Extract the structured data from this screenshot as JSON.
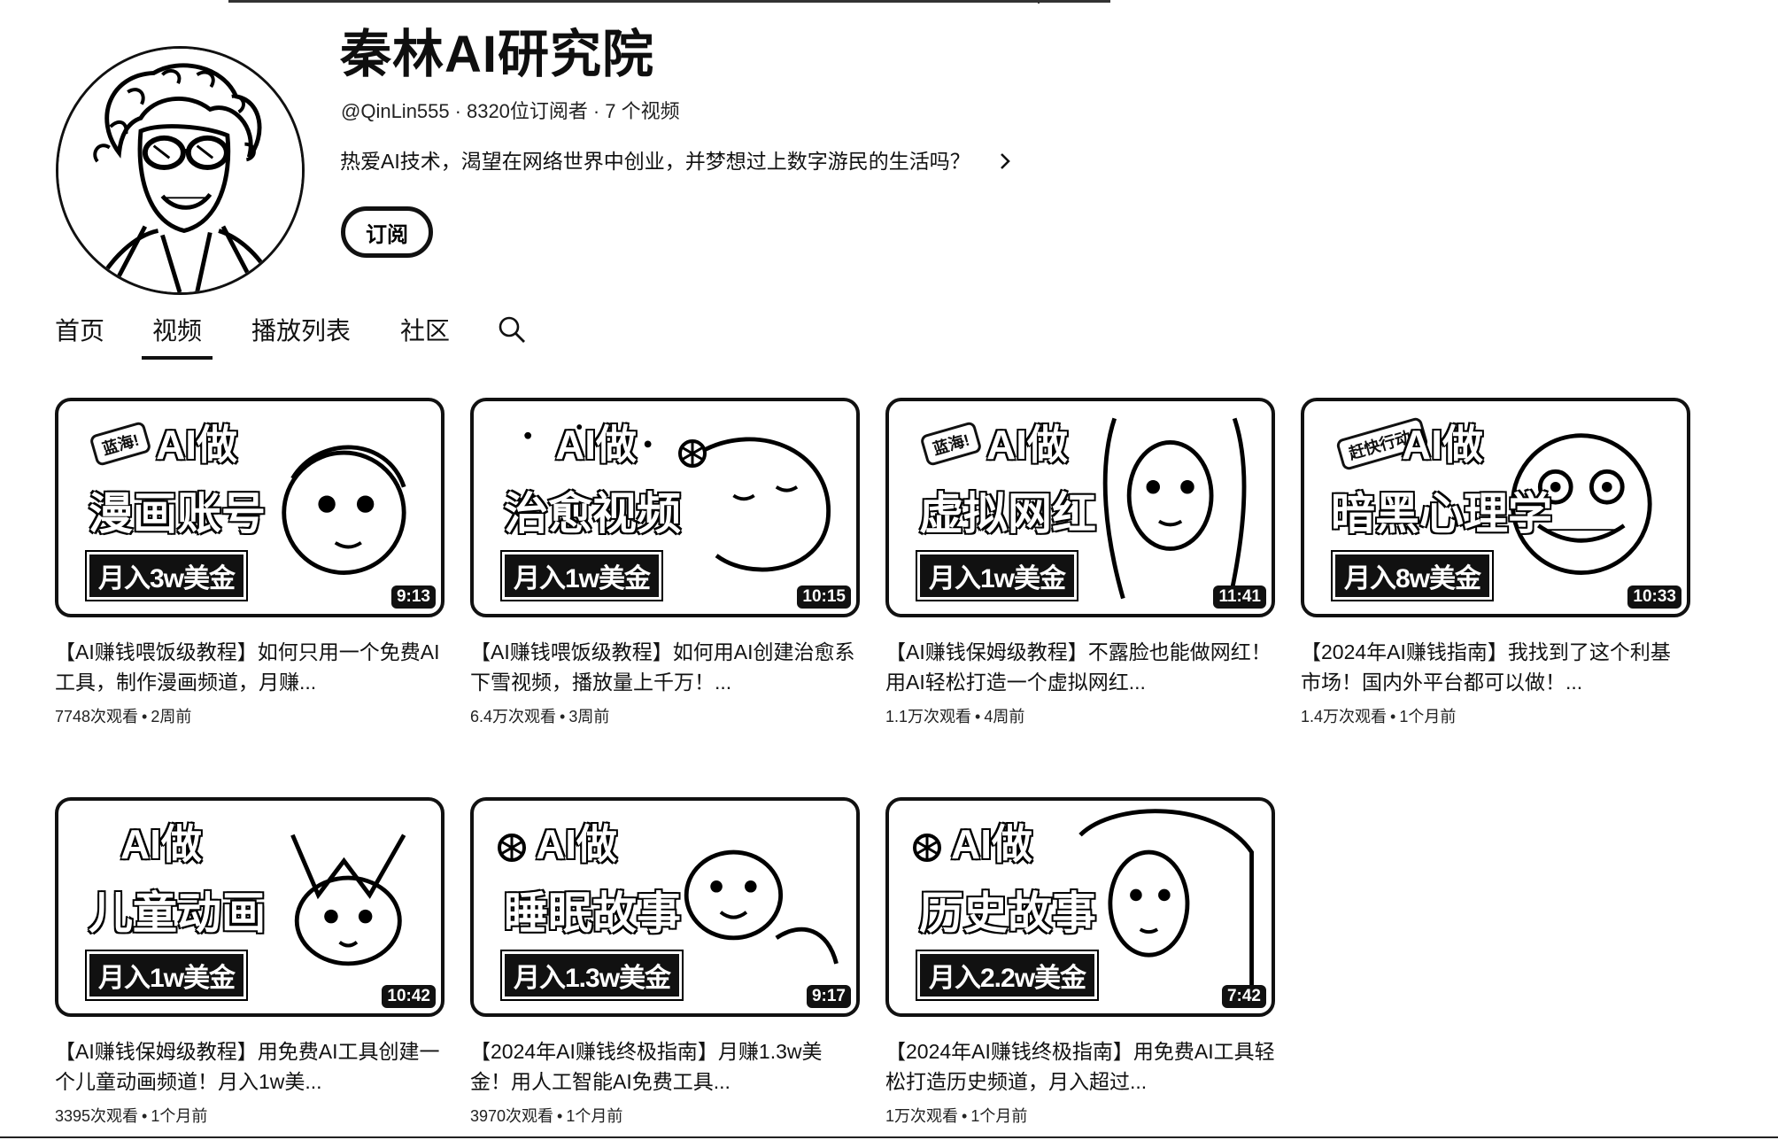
{
  "channel": {
    "name": "秦林AI研究院",
    "handle": "@QinLin555",
    "subscribers": "8320位订阅者",
    "video_count": "7 个视频",
    "description": "热爱AI技术，渴望在网络世界中创业，并梦想过上数字游民的生活吗？",
    "subscribe_label": "订阅",
    "meta_separator": "·"
  },
  "tabs": [
    {
      "label": "首页",
      "active": false
    },
    {
      "label": "视频",
      "active": true
    },
    {
      "label": "播放列表",
      "active": false
    },
    {
      "label": "社区",
      "active": false
    }
  ],
  "videos": [
    {
      "badge": "蓝海!",
      "headline_1": "AI做",
      "headline_2": "漫画账号",
      "tagline": "月入3w美金",
      "duration": "9:13",
      "title": "【AI赚钱喂饭级教程】如何只用一个免费AI工具，制作漫画频道，月赚...",
      "views": "7748次观看",
      "age": "2周前"
    },
    {
      "badge": "",
      "headline_1": "AI做",
      "headline_2": "治愈视频",
      "tagline": "月入1w美金",
      "duration": "10:15",
      "title": "【AI赚钱喂饭级教程】如何用AI创建治愈系下雪视频，播放量上千万！...",
      "views": "6.4万次观看",
      "age": "3周前"
    },
    {
      "badge": "蓝海!",
      "headline_1": "AI做",
      "headline_2": "虚拟网红",
      "tagline": "月入1w美金",
      "duration": "11:41",
      "title": "【AI赚钱保姆级教程】不露脸也能做网红！用AI轻松打造一个虚拟网红...",
      "views": "1.1万次观看",
      "age": "4周前"
    },
    {
      "badge": "赶快行动!",
      "headline_1": "AI做",
      "headline_2": "暗黑心理学",
      "tagline": "月入8w美金",
      "duration": "10:33",
      "title": "【2024年AI赚钱指南】我找到了这个利基市场！国内外平台都可以做！...",
      "views": "1.4万次观看",
      "age": "1个月前"
    },
    {
      "badge": "",
      "headline_1": "AI做",
      "headline_2": "儿童动画",
      "tagline": "月入1w美金",
      "duration": "10:42",
      "title": "【AI赚钱保姆级教程】用免费AI工具创建一个儿童动画频道！月入1w美...",
      "views": "3395次观看",
      "age": "1个月前"
    },
    {
      "badge": "",
      "headline_1": "AI做",
      "headline_2": "睡眠故事",
      "tagline": "月入1.3w美金",
      "duration": "9:17",
      "title": "【2024年AI赚钱终极指南】月赚1.3w美金！用人工智能AI免费工具...",
      "views": "3970次观看",
      "age": "1个月前"
    },
    {
      "badge": "",
      "headline_1": "AI做",
      "headline_2": "历史故事",
      "tagline": "月入2.2w美金",
      "duration": "7:42",
      "title": "【2024年AI赚钱终极指南】用免费AI工具轻松打造历史频道，月入超过...",
      "views": "1万次观看",
      "age": "1个月前"
    }
  ],
  "stats_separator": "•"
}
